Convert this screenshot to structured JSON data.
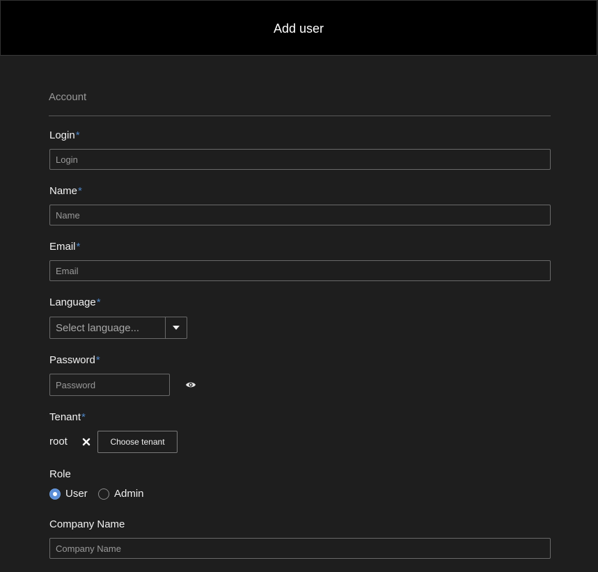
{
  "header": {
    "title": "Add user"
  },
  "form": {
    "section_title": "Account",
    "required_marker": "*",
    "login": {
      "label": "Login",
      "placeholder": "Login",
      "value": ""
    },
    "name": {
      "label": "Name",
      "placeholder": "Name",
      "value": ""
    },
    "email": {
      "label": "Email",
      "placeholder": "Email",
      "value": ""
    },
    "language": {
      "label": "Language",
      "selected": "Select language..."
    },
    "password": {
      "label": "Password",
      "placeholder": "Password",
      "value": ""
    },
    "tenant": {
      "label": "Tenant",
      "value": "root",
      "choose_button": "Choose tenant"
    },
    "role": {
      "label": "Role",
      "options": [
        {
          "label": "User",
          "checked": true
        },
        {
          "label": "Admin",
          "checked": false
        }
      ]
    },
    "company_name": {
      "label": "Company Name",
      "placeholder": "Company Name",
      "value": ""
    }
  },
  "icons": {
    "language_dropdown": "chevron-down-icon",
    "password_toggle": "eye-icon",
    "tenant_clear": "close-icon"
  },
  "colors": {
    "background": "#1e1e1e",
    "header_background": "#000000",
    "required_marker": "#4f86c6",
    "radio_accent": "#5b8ed8"
  }
}
